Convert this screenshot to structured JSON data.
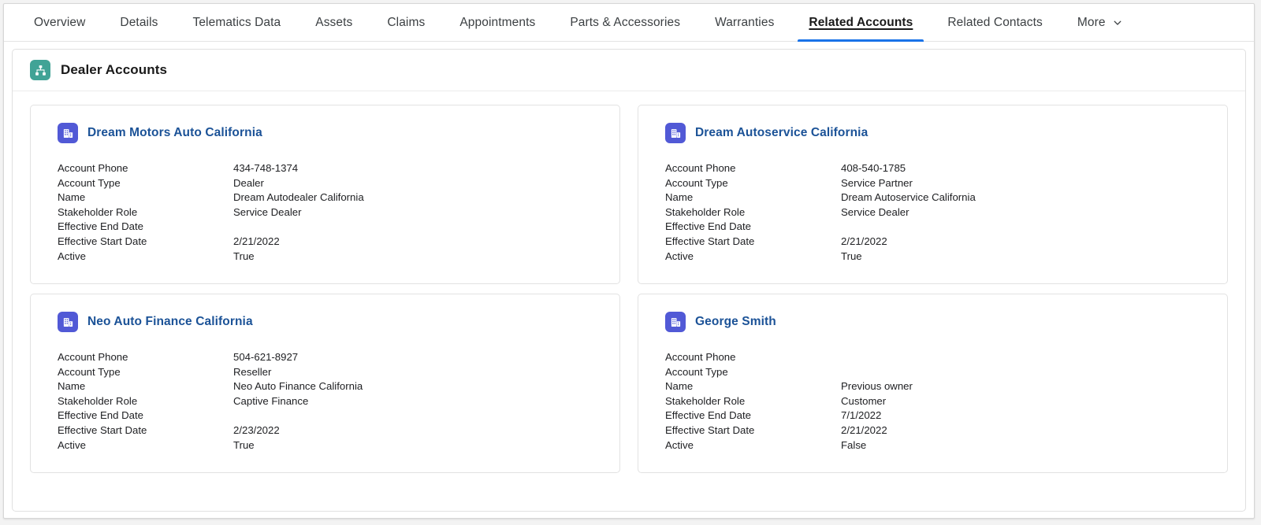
{
  "tabs": [
    {
      "label": "Overview",
      "active": false
    },
    {
      "label": "Details",
      "active": false
    },
    {
      "label": "Telematics Data",
      "active": false
    },
    {
      "label": "Assets",
      "active": false
    },
    {
      "label": "Claims",
      "active": false
    },
    {
      "label": "Appointments",
      "active": false
    },
    {
      "label": "Parts & Accessories",
      "active": false
    },
    {
      "label": "Warranties",
      "active": false
    },
    {
      "label": "Related Accounts",
      "active": true
    },
    {
      "label": "Related Contacts",
      "active": false
    },
    {
      "label": "More",
      "active": false,
      "chevron": "chevron-down-icon"
    }
  ],
  "panel": {
    "title": "Dealer Accounts",
    "icon": "org-chart-icon",
    "icon_color": "#41a396"
  },
  "card_icon": {
    "name": "building-icon",
    "color": "#5159d6"
  },
  "colors": {
    "accent_tab_underline": "#1a73e8",
    "link": "#1b5297",
    "panel_icon": "#41a396",
    "card_icon": "#5159d6"
  },
  "field_labels": [
    "Account Phone",
    "Account Type",
    "Name",
    "Stakeholder Role",
    "Effective End Date",
    "Effective Start Date",
    "Active"
  ],
  "cards": [
    {
      "title": "Dream Motors Auto California",
      "fields": [
        {
          "label": "Account Phone",
          "value": "434-748-1374"
        },
        {
          "label": "Account Type",
          "value": "Dealer"
        },
        {
          "label": "Name",
          "value": "Dream Autodealer California"
        },
        {
          "label": "Stakeholder Role",
          "value": "Service Dealer"
        },
        {
          "label": "Effective End Date",
          "value": ""
        },
        {
          "label": "Effective Start Date",
          "value": "2/21/2022"
        },
        {
          "label": "Active",
          "value": "True"
        }
      ]
    },
    {
      "title": "Dream Autoservice California",
      "fields": [
        {
          "label": "Account Phone",
          "value": "408-540-1785"
        },
        {
          "label": "Account Type",
          "value": "Service Partner"
        },
        {
          "label": "Name",
          "value": "Dream Autoservice California"
        },
        {
          "label": "Stakeholder Role",
          "value": "Service Dealer"
        },
        {
          "label": "Effective End Date",
          "value": ""
        },
        {
          "label": "Effective Start Date",
          "value": "2/21/2022"
        },
        {
          "label": "Active",
          "value": "True"
        }
      ]
    },
    {
      "title": "Neo Auto Finance California",
      "fields": [
        {
          "label": "Account Phone",
          "value": "504-621-8927"
        },
        {
          "label": "Account Type",
          "value": "Reseller"
        },
        {
          "label": "Name",
          "value": "Neo Auto Finance California"
        },
        {
          "label": "Stakeholder Role",
          "value": "Captive Finance"
        },
        {
          "label": "Effective End Date",
          "value": ""
        },
        {
          "label": "Effective Start Date",
          "value": "2/23/2022"
        },
        {
          "label": "Active",
          "value": "True"
        }
      ]
    },
    {
      "title": "George Smith",
      "fields": [
        {
          "label": "Account Phone",
          "value": ""
        },
        {
          "label": "Account Type",
          "value": ""
        },
        {
          "label": "Name",
          "value": "Previous owner"
        },
        {
          "label": "Stakeholder Role",
          "value": "Customer"
        },
        {
          "label": "Effective End Date",
          "value": "7/1/2022"
        },
        {
          "label": "Effective Start Date",
          "value": "2/21/2022"
        },
        {
          "label": "Active",
          "value": "False"
        }
      ]
    }
  ]
}
